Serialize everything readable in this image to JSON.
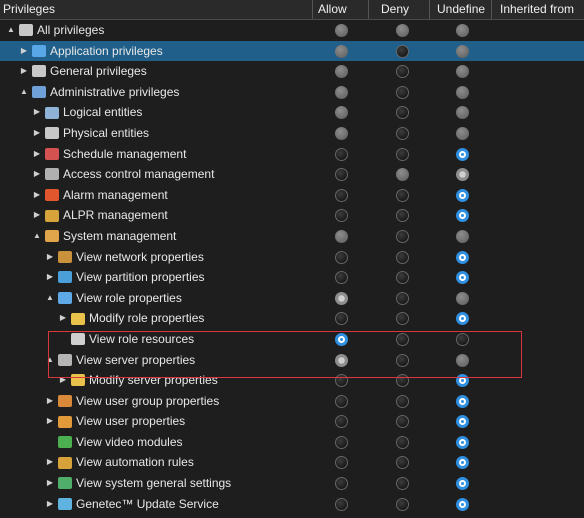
{
  "columns": {
    "privileges": "Privileges",
    "allow": "Allow",
    "deny": "Deny",
    "undefined": "Undefine",
    "inherited": "Inherited from"
  },
  "colors": {
    "selection": "#1f5f8a",
    "highlight_border": "#d9363e",
    "radio_checked": "#2f8fe0"
  },
  "rows": [
    {
      "label": "All privileges",
      "level": 0,
      "expander": "▲",
      "icon": "keys-icon",
      "icon_color": "#c8c8c8",
      "allow": "inherit",
      "deny": "inherit",
      "undef": "inherit"
    },
    {
      "label": "Application privileges",
      "level": 1,
      "expander": "▶",
      "icon": "application-icon",
      "icon_color": "#5aa7e8",
      "allow": "inherit",
      "deny": "empty",
      "undef": "inherit",
      "selected": true
    },
    {
      "label": "General privileges",
      "level": 1,
      "expander": "▶",
      "icon": "keys-icon",
      "icon_color": "#c8c8c8",
      "allow": "inherit",
      "deny": "empty",
      "undef": "inherit"
    },
    {
      "label": "Administrative privileges",
      "level": 1,
      "expander": "▲",
      "icon": "admin-icon",
      "icon_color": "#6fa0d8",
      "allow": "inherit",
      "deny": "empty",
      "undef": "inherit"
    },
    {
      "label": "Logical entities",
      "level": 2,
      "expander": "▶",
      "icon": "logical-entities-icon",
      "icon_color": "#8fb3d6",
      "allow": "inherit",
      "deny": "empty",
      "undef": "inherit"
    },
    {
      "label": "Physical entities",
      "level": 2,
      "expander": "▶",
      "icon": "keys-icon",
      "icon_color": "#c8c8c8",
      "allow": "inherit",
      "deny": "empty",
      "undef": "inherit"
    },
    {
      "label": "Schedule management",
      "level": 2,
      "expander": "▶",
      "icon": "calendar-icon",
      "icon_color": "#d4524f",
      "allow": "empty",
      "deny": "empty",
      "undef": "checked"
    },
    {
      "label": "Access control management",
      "level": 2,
      "expander": "▶",
      "icon": "door-icon",
      "icon_color": "#b0b0b0",
      "allow": "empty",
      "deny": "inherit",
      "undef": "active"
    },
    {
      "label": "Alarm management",
      "level": 2,
      "expander": "▶",
      "icon": "alarm-icon",
      "icon_color": "#e2562e",
      "allow": "empty",
      "deny": "empty",
      "undef": "checked"
    },
    {
      "label": "ALPR management",
      "level": 2,
      "expander": "▶",
      "icon": "alpr-icon",
      "icon_color": "#d7a23a",
      "allow": "empty",
      "deny": "empty",
      "undef": "checked"
    },
    {
      "label": "System management",
      "level": 2,
      "expander": "▲",
      "icon": "system-icon",
      "icon_color": "#e0a54a",
      "allow": "inherit",
      "deny": "empty",
      "undef": "inherit"
    },
    {
      "label": "View network properties",
      "level": 3,
      "expander": "▶",
      "icon": "network-icon",
      "icon_color": "#c9913b",
      "allow": "empty",
      "deny": "empty",
      "undef": "checked"
    },
    {
      "label": "View partition properties",
      "level": 3,
      "expander": "▶",
      "icon": "partition-icon",
      "icon_color": "#4b9fd8",
      "allow": "empty",
      "deny": "empty",
      "undef": "checked"
    },
    {
      "label": "View role properties",
      "level": 3,
      "expander": "▲",
      "icon": "role-icon",
      "icon_color": "#5fa8e6",
      "allow": "active",
      "deny": "empty",
      "undef": "inherit"
    },
    {
      "label": "Modify role properties",
      "level": 4,
      "expander": "▶",
      "icon": "pencil-icon",
      "icon_color": "#e8c24a",
      "allow": "empty",
      "deny": "empty",
      "undef": "checked"
    },
    {
      "label": "View role resources",
      "level": 4,
      "expander": "",
      "icon": "resources-icon",
      "icon_color": "#cfcfcf",
      "allow": "checked",
      "deny": "empty",
      "undef": "empty"
    },
    {
      "label": "View server properties",
      "level": 3,
      "expander": "▲",
      "icon": "server-icon",
      "icon_color": "#b5b5b5",
      "allow": "active",
      "deny": "empty",
      "undef": "inherit"
    },
    {
      "label": "Modify server properties",
      "level": 4,
      "expander": "▶",
      "icon": "pencil-icon",
      "icon_color": "#e8c24a",
      "allow": "empty",
      "deny": "empty",
      "undef": "checked"
    },
    {
      "label": "View user group properties",
      "level": 3,
      "expander": "▶",
      "icon": "user-group-icon",
      "icon_color": "#d9893a",
      "allow": "empty",
      "deny": "empty",
      "undef": "checked"
    },
    {
      "label": "View user properties",
      "level": 3,
      "expander": "▶",
      "icon": "user-icon",
      "icon_color": "#e09a3a",
      "allow": "empty",
      "deny": "empty",
      "undef": "checked"
    },
    {
      "label": "View video modules",
      "level": 3,
      "expander": "",
      "icon": "video-module-icon",
      "icon_color": "#4caf50",
      "allow": "empty",
      "deny": "empty",
      "undef": "checked"
    },
    {
      "label": "View automation rules",
      "level": 3,
      "expander": "▶",
      "icon": "automation-icon",
      "icon_color": "#d7a23a",
      "allow": "empty",
      "deny": "empty",
      "undef": "checked"
    },
    {
      "label": "View system general settings",
      "level": 3,
      "expander": "▶",
      "icon": "settings-icon",
      "icon_color": "#4fae6a",
      "allow": "empty",
      "deny": "empty",
      "undef": "checked"
    },
    {
      "label": "Genetec™ Update Service",
      "level": 3,
      "expander": "▶",
      "icon": "update-service-icon",
      "icon_color": "#5fb3e0",
      "allow": "empty",
      "deny": "empty",
      "undef": "checked"
    }
  ]
}
